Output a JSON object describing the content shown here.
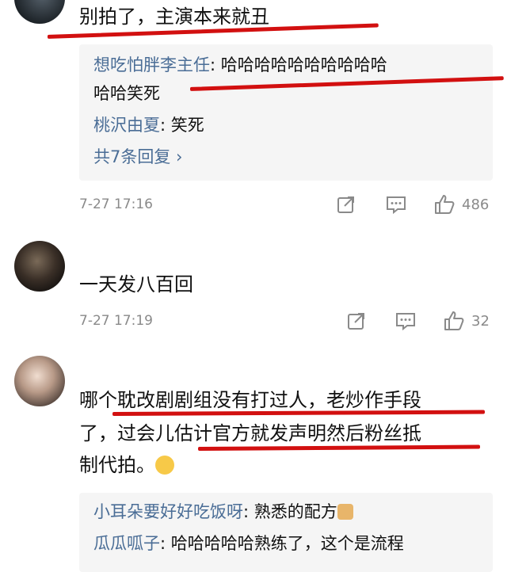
{
  "comments": [
    {
      "avatar": "avatar-dark",
      "text": "别拍了，主演本来就丑",
      "replies": [
        {
          "name": "想吃怕胖李主任",
          "sep": ":",
          "text_line1": "哈哈哈哈哈哈哈哈哈哈",
          "text_line2": "哈哈笑死"
        },
        {
          "name": "桃沢由夏",
          "sep": ":",
          "text": "笑死"
        }
      ],
      "more": "共7条回复 ›",
      "time": "7-27 17:16",
      "likes": "486"
    },
    {
      "avatar": "avatar-portrait",
      "text": "一天发八百回",
      "time": "7-27 17:19",
      "likes": "32"
    },
    {
      "avatar": "avatar-girl",
      "text_line1": "哪个耽改剧剧组没有打过人，老炒作手段",
      "text_line2": "了，过会儿估计官方就发声明然后粉丝抵",
      "text_line3": "制代拍。",
      "emoji": "shush-emoji",
      "replies": [
        {
          "name": "小耳朵要好好吃饭呀",
          "sep": ":",
          "text": "熟悉的配方",
          "emoji": "doge-emoji"
        },
        {
          "name": "瓜瓜呱子",
          "sep": ":",
          "text": "哈哈哈哈哈熟练了，这个是流程"
        }
      ]
    }
  ],
  "colors": {
    "accent_link": "#4a6d96",
    "annotation_red": "#d21010",
    "meta_gray": "#8a8a8a"
  }
}
